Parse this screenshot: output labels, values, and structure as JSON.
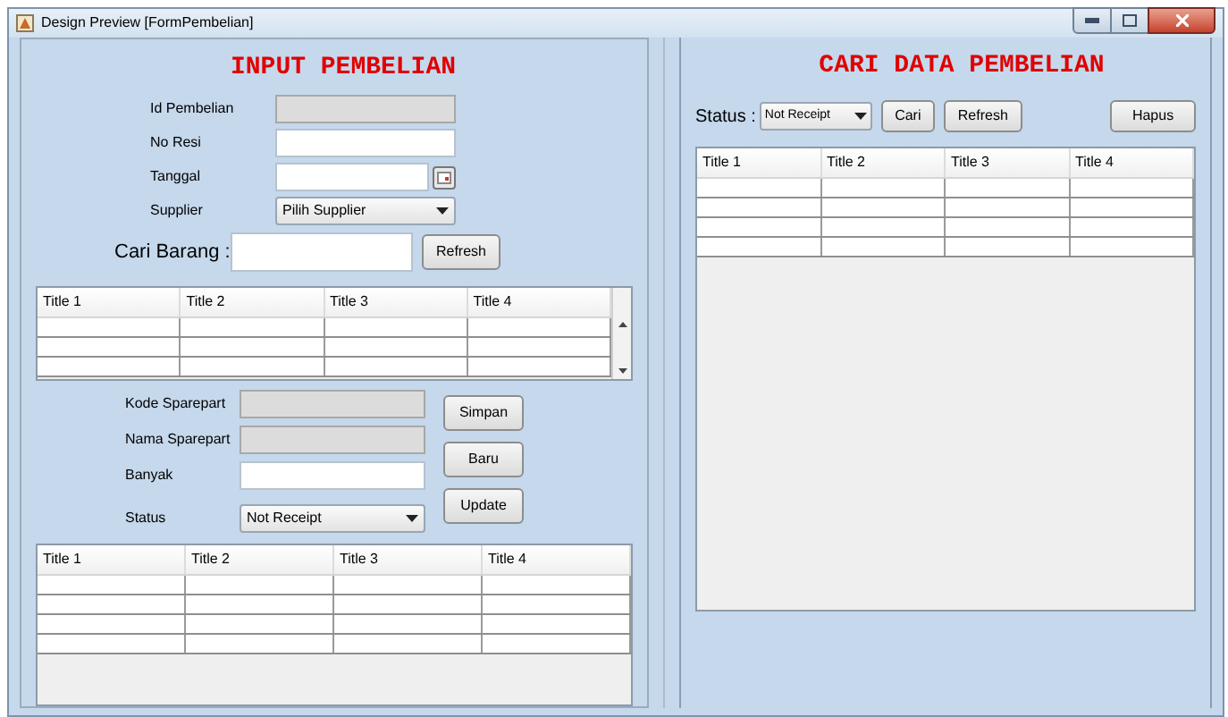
{
  "window": {
    "title": "Design Preview [FormPembelian]"
  },
  "input_panel": {
    "title": "INPUT PEMBELIAN",
    "fields": [
      {
        "label": "Id Pembelian",
        "kind": "text",
        "disabled": true
      },
      {
        "label": "No Resi",
        "kind": "text",
        "disabled": false
      },
      {
        "label": "Tanggal",
        "kind": "date",
        "disabled": false
      },
      {
        "label": "Supplier",
        "kind": "select",
        "value": "Pilih Supplier",
        "disabled": false
      }
    ],
    "search": {
      "label": "Cari Barang :",
      "button": "Refresh"
    },
    "table_top": {
      "columns": [
        "Title 1",
        "Title 2",
        "Title 3",
        "Title 4"
      ]
    },
    "item_fields": [
      {
        "label": "Kode Sparepart",
        "kind": "text",
        "disabled": true
      },
      {
        "label": "Nama Sparepart",
        "kind": "text",
        "disabled": true
      },
      {
        "label": "Banyak",
        "kind": "text",
        "disabled": false
      },
      {
        "label": "Status",
        "kind": "select",
        "value": "Not Receipt",
        "disabled": false
      }
    ],
    "buttons": [
      "Simpan",
      "Baru",
      "Update"
    ],
    "table_bottom": {
      "columns": [
        "Title 1",
        "Title 2",
        "Title 3",
        "Title 4"
      ]
    }
  },
  "search_panel": {
    "title": "CARI DATA PEMBELIAN",
    "status_label": "Status :",
    "status_value": "Not Receipt",
    "buttons": [
      "Cari",
      "Refresh"
    ],
    "delete_button": "Hapus",
    "table": {
      "columns": [
        "Title 1",
        "Title 2",
        "Title 3",
        "Title 4"
      ]
    }
  }
}
